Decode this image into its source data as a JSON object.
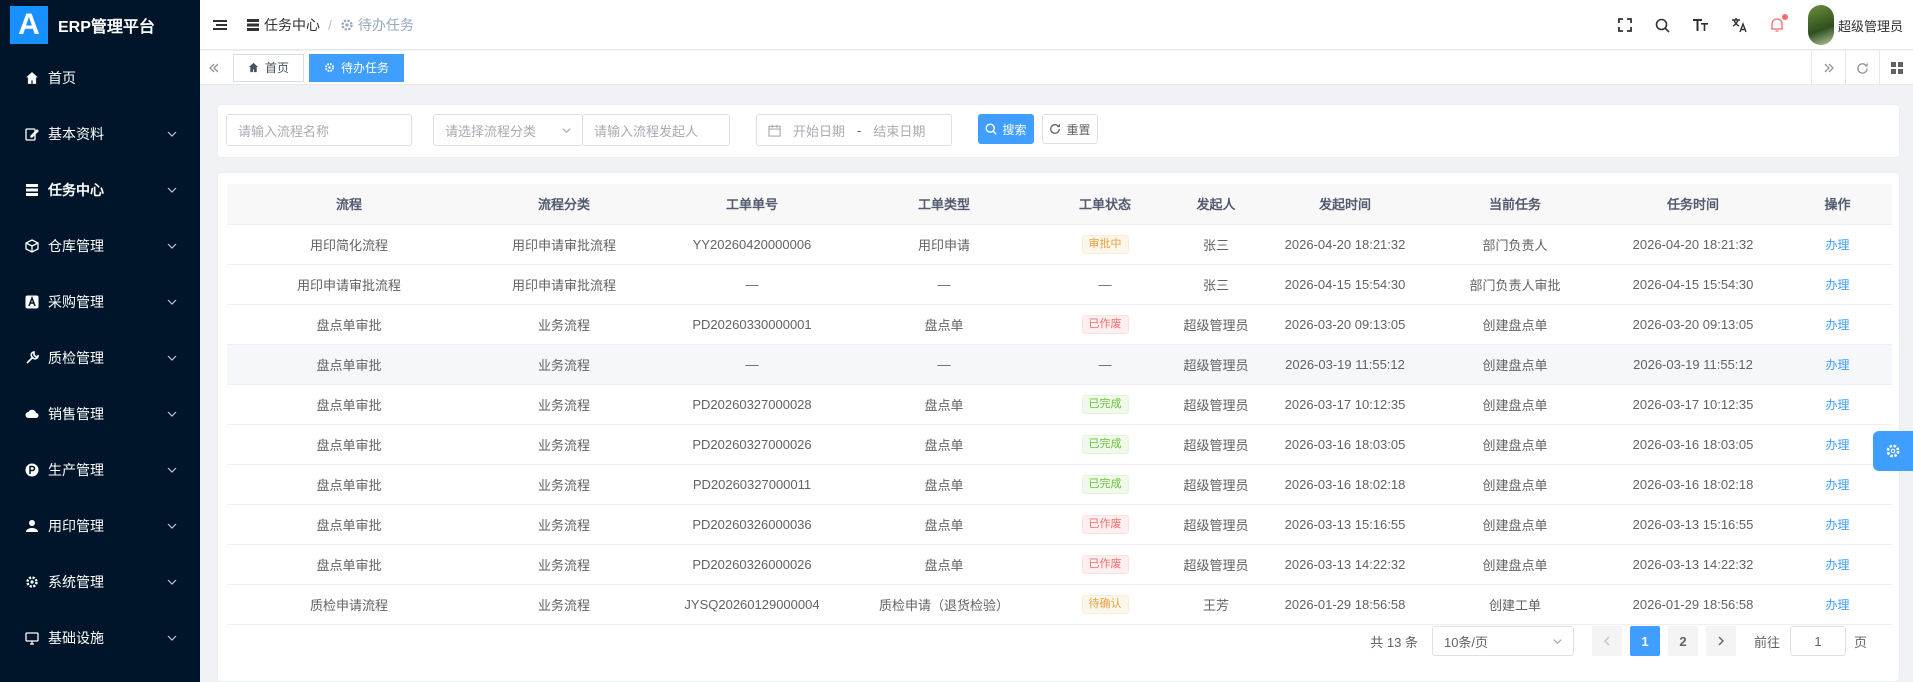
{
  "app": {
    "logo_letter": "A",
    "title": "ERP管理平台"
  },
  "sidebar": {
    "items": [
      {
        "label": "首页",
        "icon": "home-icon",
        "has_children": false
      },
      {
        "label": "基本资料",
        "icon": "edit-doc-icon",
        "has_children": true
      },
      {
        "label": "任务中心",
        "icon": "server-icon",
        "has_children": true,
        "active": true
      },
      {
        "label": "仓库管理",
        "icon": "box-icon",
        "has_children": true
      },
      {
        "label": "采购管理",
        "icon": "a-letter-icon",
        "has_children": true
      },
      {
        "label": "质检管理",
        "icon": "wrench-icon",
        "has_children": true
      },
      {
        "label": "销售管理",
        "icon": "cloud-icon",
        "has_children": true
      },
      {
        "label": "生产管理",
        "icon": "p-circle-icon",
        "has_children": true
      },
      {
        "label": "用印管理",
        "icon": "user-stamp-icon",
        "has_children": true
      },
      {
        "label": "系统管理",
        "icon": "gear-icon",
        "has_children": true
      },
      {
        "label": "基础设施",
        "icon": "monitor-icon",
        "has_children": true
      }
    ]
  },
  "header": {
    "breadcrumb": [
      {
        "label": "任务中心",
        "icon": "server-icon"
      },
      {
        "label": "待办任务",
        "icon": "gear-icon"
      }
    ],
    "separator": "/",
    "icons": [
      "fullscreen-icon",
      "search-icon",
      "font-size-icon",
      "translate-icon",
      "bell-icon"
    ],
    "username": "超级管理员"
  },
  "tags": {
    "items": [
      {
        "label": "首页",
        "icon": "home-icon",
        "active": false
      },
      {
        "label": "待办任务",
        "icon": "gear-icon",
        "active": true
      }
    ]
  },
  "search": {
    "process_name_placeholder": "请输入流程名称",
    "category_placeholder": "请选择流程分类",
    "initiator_placeholder": "请输入流程发起人",
    "start_date_placeholder": "开始日期",
    "date_separator": "-",
    "end_date_placeholder": "结束日期",
    "search_label": "搜索",
    "reset_label": "重置"
  },
  "table": {
    "columns": [
      "流程",
      "流程分类",
      "工单单号",
      "工单类型",
      "工单状态",
      "发起人",
      "发起时间",
      "当前任务",
      "任务时间",
      "操作"
    ],
    "rows": [
      {
        "process": "用印简化流程",
        "category": "用印申请审批流程",
        "order_no": "YY20260420000006",
        "order_type": "用印申请",
        "status": "审批中",
        "status_kind": "warn",
        "initiator": "张三",
        "start_time": "2026-04-20 18:21:32",
        "task": "部门负责人",
        "task_time": "2026-04-20 18:21:32",
        "action": "办理"
      },
      {
        "process": "用印申请审批流程",
        "category": "用印申请审批流程",
        "order_no": "—",
        "order_type": "—",
        "status": "—",
        "status_kind": "none",
        "initiator": "张三",
        "start_time": "2026-04-15 15:54:30",
        "task": "部门负责人审批",
        "task_time": "2026-04-15 15:54:30",
        "action": "办理"
      },
      {
        "process": "盘点单审批",
        "category": "业务流程",
        "order_no": "PD20260330000001",
        "order_type": "盘点单",
        "status": "已作废",
        "status_kind": "danger",
        "initiator": "超级管理员",
        "start_time": "2026-03-20 09:13:05",
        "task": "创建盘点单",
        "task_time": "2026-03-20 09:13:05",
        "action": "办理"
      },
      {
        "process": "盘点单审批",
        "category": "业务流程",
        "order_no": "—",
        "order_type": "—",
        "status": "—",
        "status_kind": "none",
        "initiator": "超级管理员",
        "start_time": "2026-03-19 11:55:12",
        "task": "创建盘点单",
        "task_time": "2026-03-19 11:55:12",
        "action": "办理"
      },
      {
        "process": "盘点单审批",
        "category": "业务流程",
        "order_no": "PD20260327000028",
        "order_type": "盘点单",
        "status": "已完成",
        "status_kind": "success",
        "initiator": "超级管理员",
        "start_time": "2026-03-17 10:12:35",
        "task": "创建盘点单",
        "task_time": "2026-03-17 10:12:35",
        "action": "办理"
      },
      {
        "process": "盘点单审批",
        "category": "业务流程",
        "order_no": "PD20260327000026",
        "order_type": "盘点单",
        "status": "已完成",
        "status_kind": "success",
        "initiator": "超级管理员",
        "start_time": "2026-03-16 18:03:05",
        "task": "创建盘点单",
        "task_time": "2026-03-16 18:03:05",
        "action": "办理"
      },
      {
        "process": "盘点单审批",
        "category": "业务流程",
        "order_no": "PD20260327000011",
        "order_type": "盘点单",
        "status": "已完成",
        "status_kind": "success",
        "initiator": "超级管理员",
        "start_time": "2026-03-16 18:02:18",
        "task": "创建盘点单",
        "task_time": "2026-03-16 18:02:18",
        "action": "办理"
      },
      {
        "process": "盘点单审批",
        "category": "业务流程",
        "order_no": "PD20260326000036",
        "order_type": "盘点单",
        "status": "已作废",
        "status_kind": "danger",
        "initiator": "超级管理员",
        "start_time": "2026-03-13 15:16:55",
        "task": "创建盘点单",
        "task_time": "2026-03-13 15:16:55",
        "action": "办理"
      },
      {
        "process": "盘点单审批",
        "category": "业务流程",
        "order_no": "PD20260326000026",
        "order_type": "盘点单",
        "status": "已作废",
        "status_kind": "danger",
        "initiator": "超级管理员",
        "start_time": "2026-03-13 14:22:32",
        "task": "创建盘点单",
        "task_time": "2026-03-13 14:22:32",
        "action": "办理"
      },
      {
        "process": "质检申请流程",
        "category": "业务流程",
        "order_no": "JYSQ20260129000004",
        "order_type": "质检申请（退货检验）",
        "status": "待确认",
        "status_kind": "warn",
        "initiator": "王芳",
        "start_time": "2026-01-29 18:56:58",
        "task": "创建工单",
        "task_time": "2026-01-29 18:56:58",
        "action": "办理"
      }
    ]
  },
  "pagination": {
    "total_text": "共 13 条",
    "page_size": "10条/页",
    "pages": [
      "1",
      "2"
    ],
    "current_page": "1",
    "jump_label": "前往",
    "jump_value": "1",
    "jump_suffix": "页"
  },
  "colors": {
    "primary": "#409eff",
    "sidebar_bg": "#001529",
    "logo_bg": "#1890ff"
  }
}
